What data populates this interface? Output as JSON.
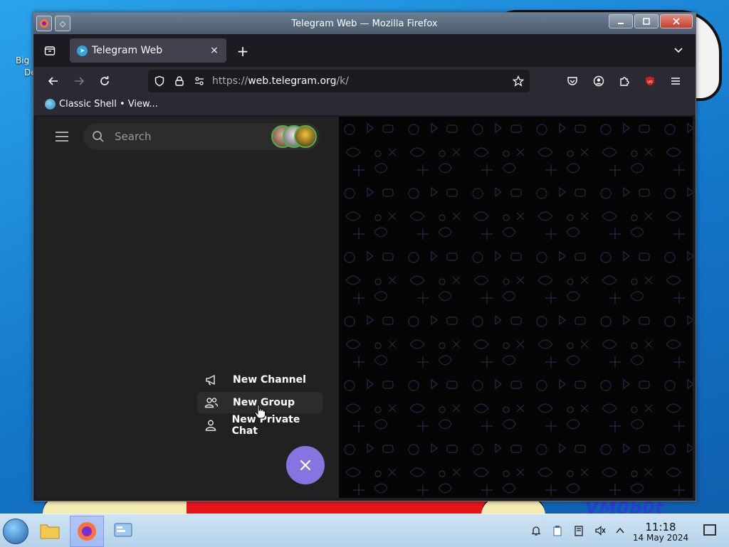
{
  "window": {
    "title": "Telegram Web — Mozilla Firefox"
  },
  "tabs": [
    {
      "title": "Telegram Web",
      "close": "×"
    }
  ],
  "new_tab": "+",
  "url": {
    "scheme": "https://",
    "host": "web.telegram.org",
    "path": "/k/"
  },
  "bookmarks": [
    {
      "label": "Classic Shell • View..."
    }
  ],
  "telegram": {
    "search_placeholder": "Search",
    "menu": [
      {
        "label": "New Channel",
        "icon": "megaphone-icon"
      },
      {
        "label": "New Group",
        "icon": "group-icon"
      },
      {
        "label": "New Private Chat",
        "icon": "user-icon"
      }
    ],
    "fab_icon": "close-icon",
    "accent": "#8774e1"
  },
  "taskbar": {
    "time": "11:18",
    "date": "14 May 2024"
  },
  "desktop": {
    "icon_label_1": "Big",
    "icon_label_2": "De",
    "wallpaper_brand": "VM0b0t"
  }
}
